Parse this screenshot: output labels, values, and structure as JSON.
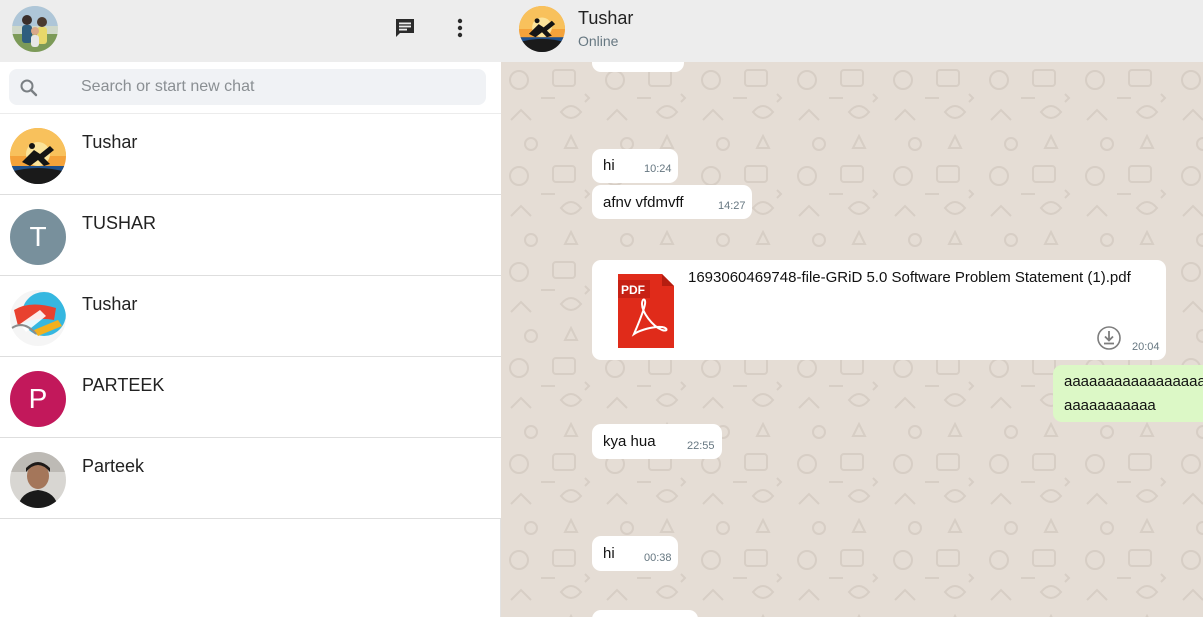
{
  "sidebar": {
    "search": {
      "placeholder": "Search or start new chat"
    },
    "chats": [
      {
        "name": "Tushar",
        "avatar": "photo-skateboard"
      },
      {
        "name": "TUSHAR",
        "avatar_letter": "T",
        "avatar_color": "#78909c"
      },
      {
        "name": "Tushar",
        "avatar": "photo-illustration"
      },
      {
        "name": "PARTEEK",
        "avatar_letter": "P",
        "avatar_color": "#c2185b"
      },
      {
        "name": "Parteek",
        "avatar": "photo-portrait"
      }
    ]
  },
  "conversation": {
    "contact_name": "Tushar",
    "status": "Online",
    "messages": [
      {
        "text": "hi",
        "time": "10:24",
        "direction": "incoming"
      },
      {
        "text": "afnv vfdmvff",
        "time": "14:27",
        "direction": "incoming"
      },
      {
        "file_name": "1693060469748-file-GRiD 5.0 Software Problem Statement (1).pdf",
        "file_badge": "PDF",
        "time": "20:04",
        "direction": "incoming"
      },
      {
        "lines": [
          "aaaaaaaaaaaaaaaaaaa",
          "aaaaaaaaaaa"
        ],
        "direction": "outgoing"
      },
      {
        "text": "kya hua",
        "time": "22:55",
        "direction": "incoming"
      },
      {
        "text": "hi",
        "time": "00:38",
        "direction": "incoming"
      }
    ]
  },
  "icons": {
    "new_chat": "chat-bubble-icon",
    "menu": "vertical-dots-icon",
    "search": "search-icon",
    "download": "download-icon",
    "file": "pdf-icon"
  },
  "colors": {
    "header_bg": "#ededed",
    "chat_bg": "#e5ddd5",
    "incoming_bubble": "#ffffff",
    "outgoing_bubble": "#dcf8c6",
    "pdf_red": "#e02b1a",
    "icon_dark": "#2b2b2b"
  }
}
